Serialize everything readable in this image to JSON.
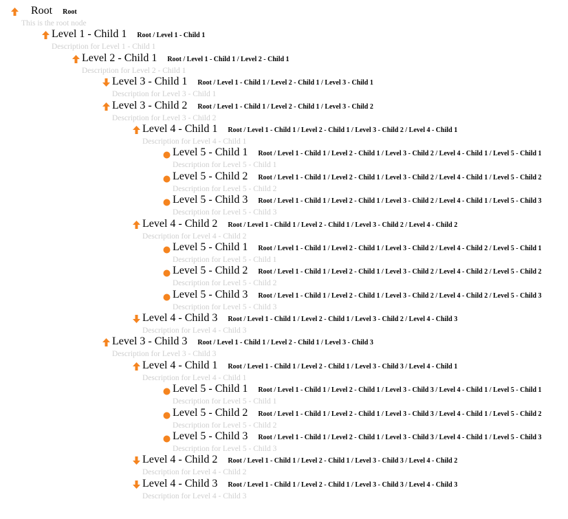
{
  "accent_color": "#f5841f",
  "tree": {
    "title": "Root",
    "path": "Root",
    "description": "This is the root node",
    "icon": "arrow-up-icon",
    "children": [
      {
        "title": "Level 1 - Child 1",
        "path": "Root / Level 1 - Child 1",
        "description": "Description for Level 1 - Child 1",
        "icon": "arrow-up-icon",
        "children": [
          {
            "title": "Level 2 - Child 1",
            "path": "Root / Level 1 - Child 1 / Level 2 - Child 1",
            "description": "Description for Level 2 - Child 1",
            "icon": "arrow-up-icon",
            "children": [
              {
                "title": "Level 3 - Child 1",
                "path": "Root / Level 1 - Child 1 / Level 2 - Child 1 / Level 3 - Child 1",
                "description": "Description for Level 3 - Child 1",
                "icon": "arrow-down-icon",
                "children": []
              },
              {
                "title": "Level 3 - Child 2",
                "path": "Root / Level 1 - Child 1 / Level 2 - Child 1 / Level 3 - Child 2",
                "description": "Description for Level 3 - Child 2",
                "icon": "arrow-up-icon",
                "children": [
                  {
                    "title": "Level 4 - Child 1",
                    "path": "Root / Level 1 - Child 1 / Level 2 - Child 1 / Level 3 - Child 2 / Level 4 - Child 1",
                    "description": "Description for Level 4 - Child 1",
                    "icon": "arrow-up-icon",
                    "children": [
                      {
                        "title": "Level 5 - Child 1",
                        "path": "Root / Level 1 - Child 1 / Level 2 - Child 1 / Level 3 - Child 2 / Level 4 - Child 1 / Level 5 - Child 1",
                        "description": "Description for Level 5 - Child 1",
                        "icon": "dot-icon",
                        "children": []
                      },
                      {
                        "title": "Level 5 - Child 2",
                        "path": "Root / Level 1 - Child 1 / Level 2 - Child 1 / Level 3 - Child 2 / Level 4 - Child 1 / Level 5 - Child 2",
                        "description": "Description for Level 5 - Child 2",
                        "icon": "dot-icon",
                        "children": []
                      },
                      {
                        "title": "Level 5 - Child 3",
                        "path": "Root / Level 1 - Child 1 / Level 2 - Child 1 / Level 3 - Child 2 / Level 4 - Child 1 / Level 5 - Child 3",
                        "description": "Description for Level 5 - Child 3",
                        "icon": "dot-icon",
                        "children": []
                      }
                    ]
                  },
                  {
                    "title": "Level 4 - Child 2",
                    "path": "Root / Level 1 - Child 1 / Level 2 - Child 1 / Level 3 - Child 2 / Level 4 - Child 2",
                    "description": "Description for Level 4 - Child 2",
                    "icon": "arrow-up-icon",
                    "children": [
                      {
                        "title": "Level 5 - Child 1",
                        "path": "Root / Level 1 - Child 1 / Level 2 - Child 1 / Level 3 - Child 2 / Level 4 - Child 2 / Level 5 - Child 1",
                        "description": "Description for Level 5 - Child 1",
                        "icon": "dot-icon",
                        "children": []
                      },
                      {
                        "title": "Level 5 - Child 2",
                        "path": "Root / Level 1 - Child 1 / Level 2 - Child 1 / Level 3 - Child 2 / Level 4 - Child 2 / Level 5 - Child 2",
                        "description": "Description for Level 5 - Child 2",
                        "icon": "dot-icon",
                        "children": []
                      },
                      {
                        "title": "Level 5 - Child 3",
                        "path": "Root / Level 1 - Child 1 / Level 2 - Child 1 / Level 3 - Child 2 / Level 4 - Child 2 / Level 5 - Child 3",
                        "description": "Description for Level 5 - Child 3",
                        "icon": "dot-icon",
                        "children": []
                      }
                    ]
                  },
                  {
                    "title": "Level 4 - Child 3",
                    "path": "Root / Level 1 - Child 1 / Level 2 - Child 1 / Level 3 - Child 2 / Level 4 - Child 3",
                    "description": "Description for Level 4 - Child 3",
                    "icon": "arrow-down-icon",
                    "children": []
                  }
                ]
              },
              {
                "title": "Level 3 - Child 3",
                "path": "Root / Level 1 - Child 1 / Level 2 - Child 1 / Level 3 - Child 3",
                "description": "Description for Level 3 - Child 3",
                "icon": "arrow-up-icon",
                "children": [
                  {
                    "title": "Level 4 - Child 1",
                    "path": "Root / Level 1 - Child 1 / Level 2 - Child 1 / Level 3 - Child 3 / Level 4 - Child 1",
                    "description": "Description for Level 4 - Child 1",
                    "icon": "arrow-up-icon",
                    "children": [
                      {
                        "title": "Level 5 - Child 1",
                        "path": "Root / Level 1 - Child 1 / Level 2 - Child 1 / Level 3 - Child 3 / Level 4 - Child 1 / Level 5 - Child 1",
                        "description": "Description for Level 5 - Child 1",
                        "icon": "dot-icon",
                        "children": []
                      },
                      {
                        "title": "Level 5 - Child 2",
                        "path": "Root / Level 1 - Child 1 / Level 2 - Child 1 / Level 3 - Child 3 / Level 4 - Child 1 / Level 5 - Child 2",
                        "description": "Description for Level 5 - Child 2",
                        "icon": "dot-icon",
                        "children": []
                      },
                      {
                        "title": "Level 5 - Child 3",
                        "path": "Root / Level 1 - Child 1 / Level 2 - Child 1 / Level 3 - Child 3 / Level 4 - Child 1 / Level 5 - Child 3",
                        "description": "Description for Level 5 - Child 3",
                        "icon": "dot-icon",
                        "children": []
                      }
                    ]
                  },
                  {
                    "title": "Level 4 - Child 2",
                    "path": "Root / Level 1 - Child 1 / Level 2 - Child 1 / Level 3 - Child 3 / Level 4 - Child 2",
                    "description": "Description for Level 4 - Child 2",
                    "icon": "arrow-down-icon",
                    "children": []
                  },
                  {
                    "title": "Level 4 - Child 3",
                    "path": "Root / Level 1 - Child 1 / Level 2 - Child 1 / Level 3 - Child 3 / Level 4 - Child 3",
                    "description": "Description for Level 4 - Child 3",
                    "icon": "arrow-down-icon",
                    "children": []
                  }
                ]
              }
            ]
          }
        ]
      }
    ]
  }
}
